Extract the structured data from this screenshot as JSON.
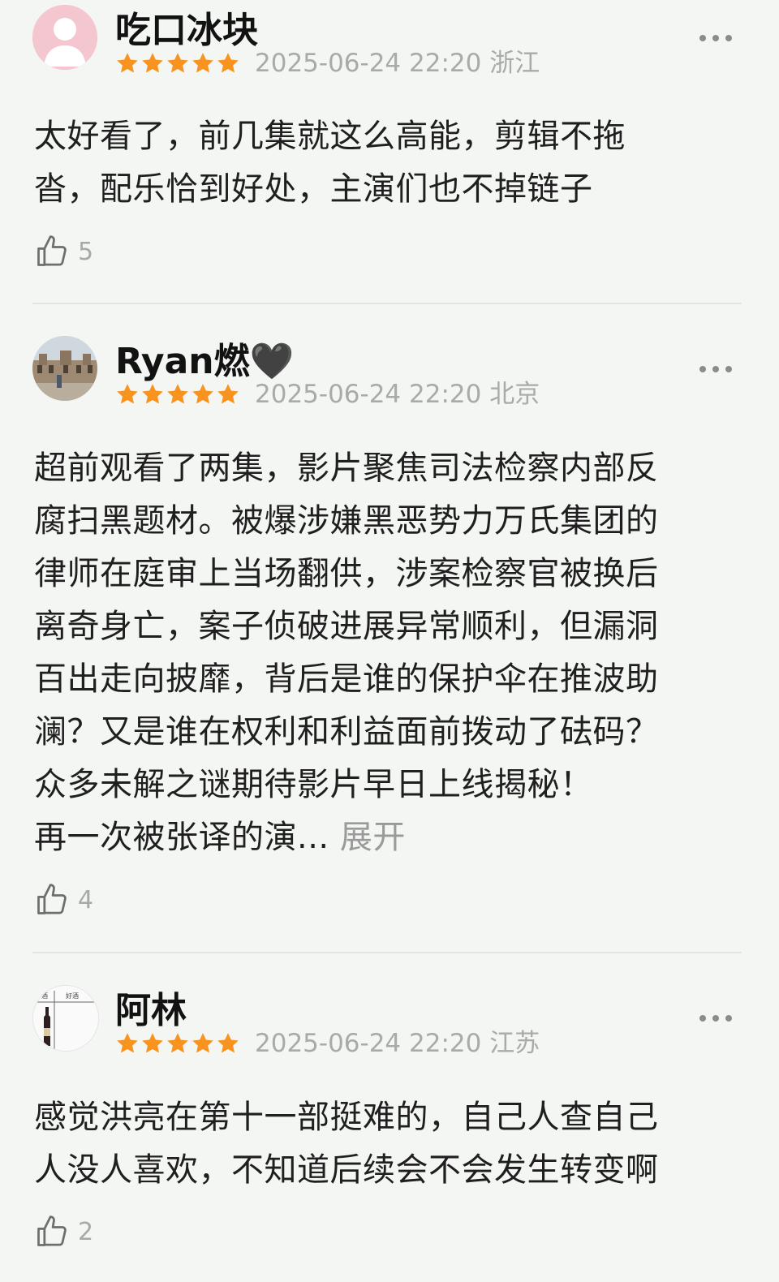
{
  "comments": [
    {
      "username": "吃口冰块",
      "rating": 5,
      "meta": "2025-06-24 22:20 浙江",
      "lines": [
        "太好看了，前几集就这么高能，剪辑不拖",
        "沓，配乐恰到好处，主演们也不掉链子"
      ],
      "likes": "5",
      "avatar_icon": "default-person-avatar"
    },
    {
      "username": "Ryan燃🖤",
      "rating": 5,
      "meta": "2025-06-24 22:20 北京",
      "lines": [
        "超前观看了两集，影片聚焦司法检察内部反",
        "腐扫黑题材。被爆涉嫌黑恶势力万氏集团的",
        "律师在庭审上当场翻供，涉案检察官被换后",
        "离奇身亡，案子侦破进展异常顺利，但漏洞",
        "百出走向披靡，背后是谁的保护伞在推波助",
        "澜？又是谁在权利和利益面前拨动了砝码？",
        "众多未解之谜期待影片早日上线揭秘！",
        "再一次被张译的演..."
      ],
      "expand_label": "展开",
      "likes": "4",
      "avatar_icon": "building-photo-avatar"
    },
    {
      "username": "阿林",
      "rating": 5,
      "meta": "2025-06-24 22:20 江苏",
      "lines": [
        "感觉洪亮在第十一部挺难的，自己人查自己",
        "人没人喜欢，不知道后续会不会发生转变啊"
      ],
      "likes": "2",
      "avatar_icon": "wine-bottle-avatar",
      "avatar_text": [
        "酒",
        "好酒"
      ]
    }
  ],
  "colors": {
    "background": "#f3f6f2",
    "star": "#f7931e",
    "meta_text": "#a9aaa9",
    "body_text": "#1f1f1f",
    "expand": "#9a9a9a"
  }
}
